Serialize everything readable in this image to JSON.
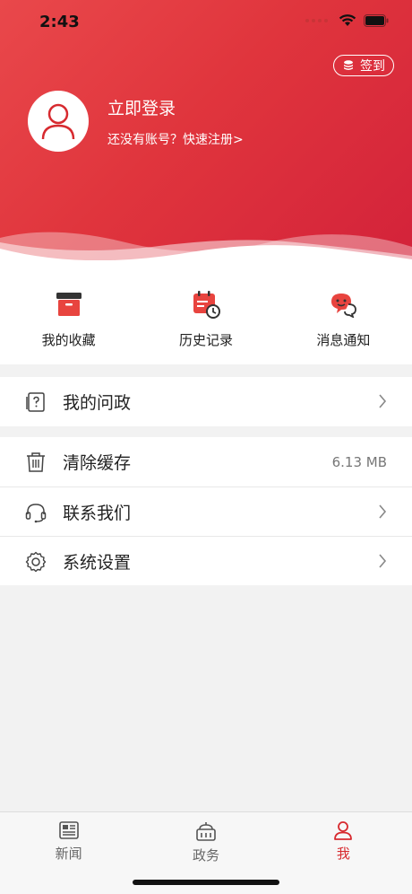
{
  "status_bar": {
    "time": "2:43"
  },
  "header": {
    "checkin_label": "签到",
    "login_title": "立即登录",
    "login_subtitle": "还没有账号？快速注册>"
  },
  "quick_actions": [
    {
      "label": "我的收藏",
      "icon": "archive-box-icon"
    },
    {
      "label": "历史记录",
      "icon": "calendar-clock-icon"
    },
    {
      "label": "消息通知",
      "icon": "chat-bubble-icon"
    }
  ],
  "menu_group_1": [
    {
      "label": "我的问政",
      "icon": "question-doc-icon"
    }
  ],
  "menu_group_2": [
    {
      "label": "清除缓存",
      "icon": "trash-icon",
      "value": "6.13 MB"
    },
    {
      "label": "联系我们",
      "icon": "headset-icon"
    },
    {
      "label": "系统设置",
      "icon": "gear-icon"
    }
  ],
  "tabbar": [
    {
      "label": "新闻",
      "icon": "newspaper-icon",
      "active": false
    },
    {
      "label": "政务",
      "icon": "government-building-icon",
      "active": false
    },
    {
      "label": "我",
      "icon": "person-icon",
      "active": true
    }
  ],
  "colors": {
    "accent": "#d72a2f",
    "header_start": "#e9484b",
    "header_end": "#d3223a"
  }
}
